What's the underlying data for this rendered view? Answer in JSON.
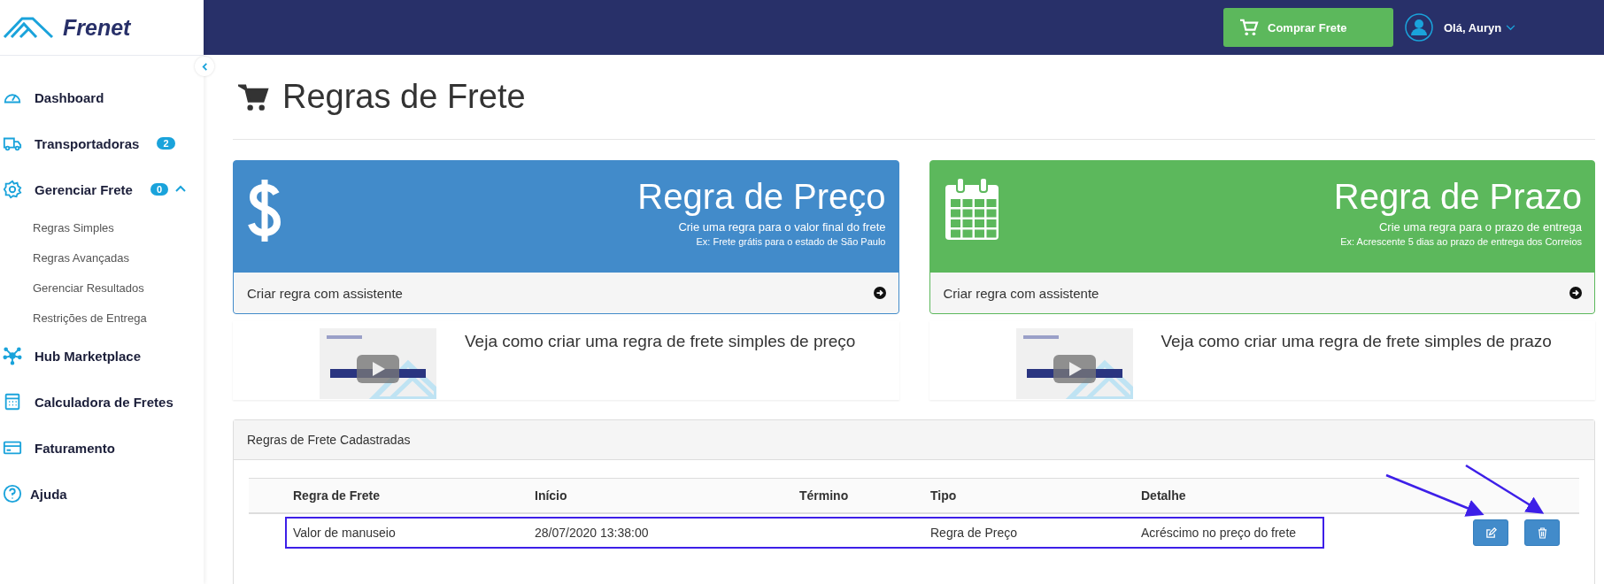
{
  "sidebar": {
    "logo": "Frenet",
    "items": [
      {
        "label": "Dashboard"
      },
      {
        "label": "Transportadoras",
        "badge": "2"
      },
      {
        "label": "Gerenciar Frete",
        "badge": "0",
        "expanded": true,
        "children": [
          {
            "label": "Regras Simples"
          },
          {
            "label": "Regras Avançadas"
          },
          {
            "label": "Gerenciar Resultados"
          },
          {
            "label": "Restrições de Entrega"
          }
        ]
      },
      {
        "label": "Hub Marketplace"
      },
      {
        "label": "Calculadora de Fretes"
      },
      {
        "label": "Faturamento"
      },
      {
        "label": "Ajuda"
      }
    ]
  },
  "header": {
    "buy_button": "Comprar Frete",
    "user": "Olá, Auryn"
  },
  "page": {
    "title": "Regras de Frete"
  },
  "cards": [
    {
      "kind": "price",
      "title": "Regra de Preço",
      "subtitle": "Crie uma regra para o valor final do frete",
      "example": "Ex: Frete grátis para o estado de São Paulo",
      "action": "Criar regra com assistente",
      "video_text": "Veja como criar uma regra de frete simples de preço"
    },
    {
      "kind": "deadline",
      "title": "Regra de Prazo",
      "subtitle": "Crie uma regra para o prazo de entrega",
      "example": "Ex: Acrescente 5 dias ao prazo de entrega dos Correios",
      "action": "Criar regra com assistente",
      "video_text": "Veja como criar uma regra de frete simples de prazo"
    }
  ],
  "rules_panel": {
    "title": "Regras de Frete Cadastradas",
    "columns": [
      "Regra de Frete",
      "Início",
      "Término",
      "Tipo",
      "Detalhe"
    ],
    "rows": [
      {
        "cells": [
          "Valor de manuseio",
          "28/07/2020 13:38:00",
          "",
          "Regra de Preço",
          "Acréscimo no preço do frete"
        ],
        "highlighted": true
      }
    ]
  }
}
